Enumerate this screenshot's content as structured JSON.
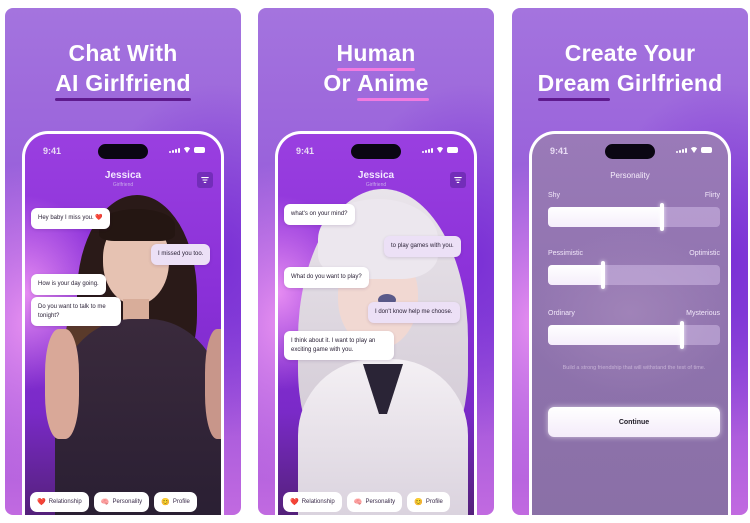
{
  "panels": [
    {
      "headline": {
        "line1": "Chat With",
        "line2": "AI Girlfriend",
        "underline_word": "AI Girlfriend",
        "underline_color": "#5f1a8e"
      },
      "phone": {
        "status": {
          "time": "9:41"
        },
        "header": {
          "name": "Jessica",
          "subtitle": "Girlfriend"
        },
        "character_style": "human",
        "messages": [
          {
            "from": "ai",
            "text": "Hey baby I miss you. ❤️"
          },
          {
            "from": "user",
            "text": "I missed you too."
          },
          {
            "from": "ai",
            "text": "How is your day going."
          },
          {
            "from": "ai",
            "text": "Do you want to talk to me tonight?"
          }
        ],
        "tabs": [
          {
            "icon": "heart-icon",
            "glyph": "❤️",
            "label": "Relationship"
          },
          {
            "icon": "brain-icon",
            "glyph": "🧠",
            "label": "Personality"
          },
          {
            "icon": "smiley-icon",
            "glyph": "😊",
            "label": "Profile"
          }
        ]
      }
    },
    {
      "headline": {
        "line1": "Human",
        "line2_prefix": "Or",
        "line2_word": "Anime",
        "underline_color": "#f27ae0"
      },
      "phone": {
        "status": {
          "time": "9:41"
        },
        "header": {
          "name": "Jessica",
          "subtitle": "Girlfriend"
        },
        "character_style": "anime",
        "messages": [
          {
            "from": "ai",
            "text": "what's on your mind?"
          },
          {
            "from": "user",
            "text": "to play games with you."
          },
          {
            "from": "ai",
            "text": "What do you want to play?"
          },
          {
            "from": "user",
            "text": "I don't know help me choose."
          },
          {
            "from": "ai",
            "text": "I think about it. I want to play an exciting game with you."
          }
        ],
        "tabs": [
          {
            "icon": "heart-icon",
            "glyph": "❤️",
            "label": "Relationship"
          },
          {
            "icon": "brain-icon",
            "glyph": "🧠",
            "label": "Personality"
          },
          {
            "icon": "smiley-icon",
            "glyph": "😊",
            "label": "Profile"
          }
        ]
      }
    },
    {
      "headline": {
        "line1": "Create Your",
        "line2_word": "Dream",
        "line2_suffix": "Girlfriend",
        "underline_color": "#5f1a8e"
      },
      "phone": {
        "status": {
          "time": "9:41"
        },
        "title": "Personality",
        "sliders": [
          {
            "left": "Shy",
            "right": "Flirty",
            "value": 0.66
          },
          {
            "left": "Pessimistic",
            "right": "Optimistic",
            "value": 0.32
          },
          {
            "left": "Ordinary",
            "right": "Mysterious",
            "value": 0.78
          }
        ],
        "hint": "Build a strong friendship that will withstand the test of time.",
        "continue_label": "Continue"
      }
    }
  ],
  "colors": {
    "panel_top": "#a474de",
    "panel_accent": "#8f4bd8",
    "bubble_ai": "#ffffff",
    "bubble_user": "#ece0f6"
  }
}
